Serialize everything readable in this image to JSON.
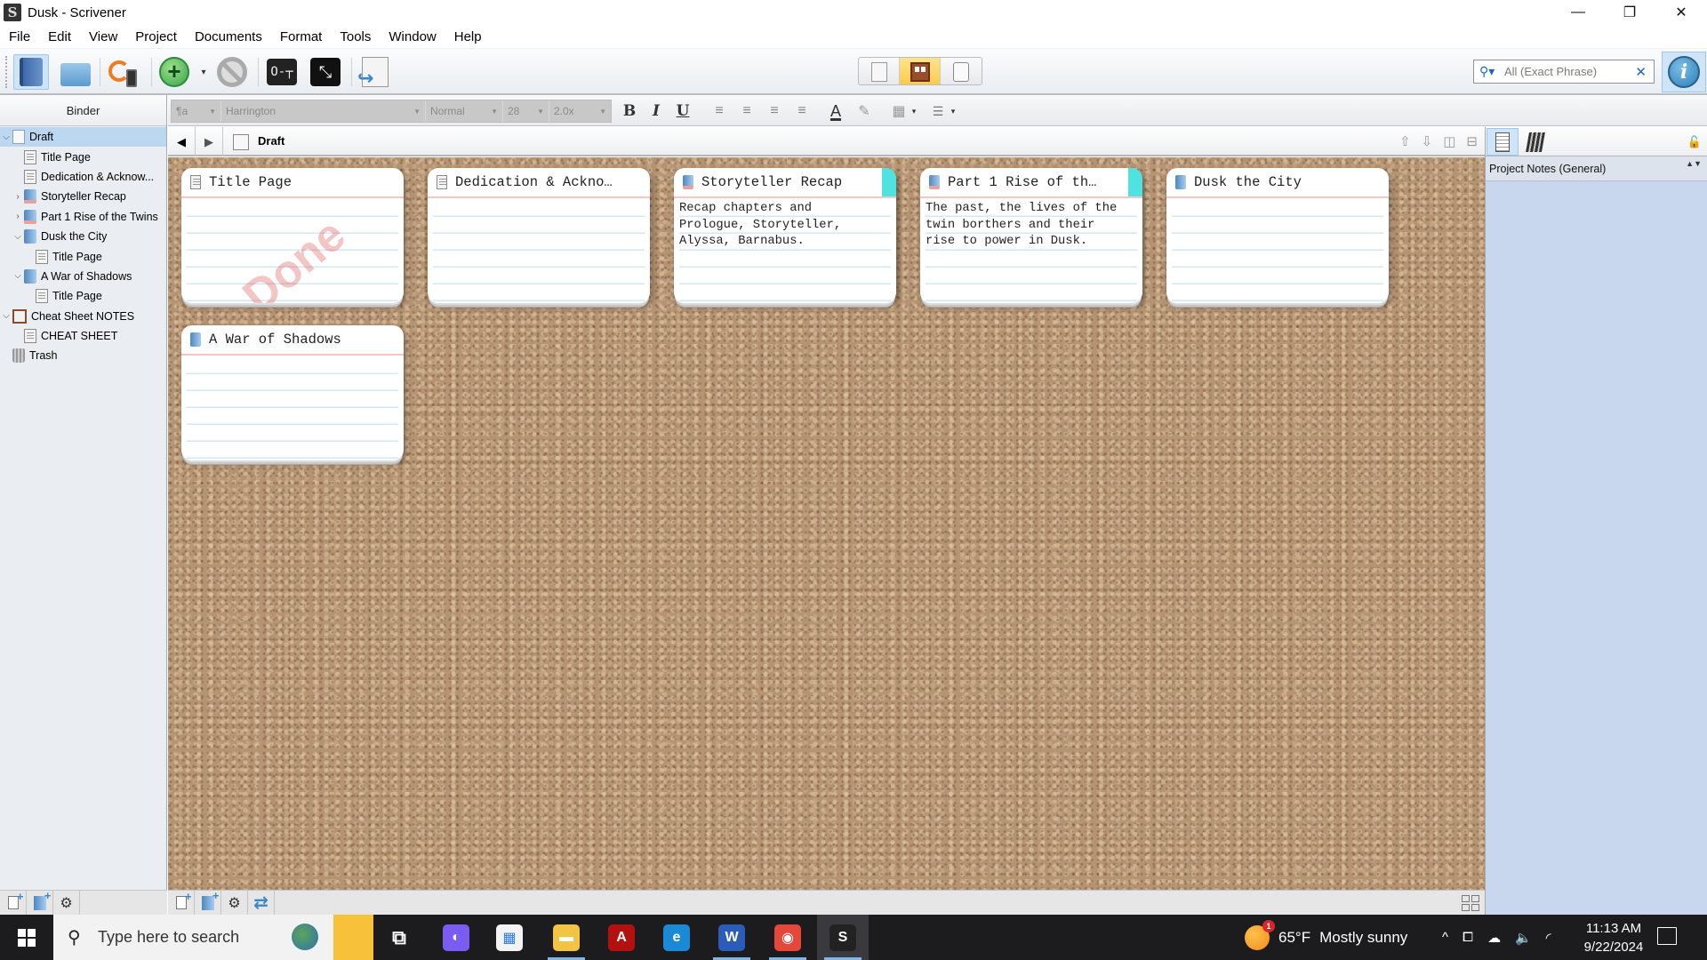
{
  "window": {
    "title": "Dusk - Scrivener",
    "app_icon": "S",
    "controls": {
      "minimize": "—",
      "restore": "❐",
      "close": "✕"
    }
  },
  "menu": [
    "File",
    "Edit",
    "View",
    "Project",
    "Documents",
    "Format",
    "Tools",
    "Window",
    "Help"
  ],
  "toolbar": {
    "buttons": [
      {
        "name": "binder-toggle",
        "icon": "binder-icon",
        "active": true
      },
      {
        "name": "collections",
        "icon": "folder-icon"
      },
      {
        "name": "sync",
        "icon": "sync-icon"
      },
      {
        "name": "add",
        "icon": "add-icon",
        "glyph": "+"
      },
      {
        "name": "delete",
        "icon": "no-icon"
      },
      {
        "name": "keywords",
        "icon": "key-icon",
        "glyph": "O-┬"
      },
      {
        "name": "composition-mode",
        "icon": "fullscreen-icon",
        "glyph": "⤡"
      },
      {
        "name": "compile",
        "icon": "compile-icon"
      }
    ],
    "add_dropdown": "▾",
    "view_modes": [
      {
        "name": "scrivenings",
        "active": false
      },
      {
        "name": "corkboard",
        "active": true
      },
      {
        "name": "outliner",
        "active": false
      }
    ],
    "search": {
      "icon": "⚲▾",
      "placeholder": "All (Exact Phrase)",
      "clear": "✕"
    },
    "inspector_glyph": "i"
  },
  "format_bar": {
    "style_glyph": "¶a",
    "font": "Harrington",
    "typeface": "Normal",
    "size": "28",
    "line_spacing": "2.0x",
    "dropdown_glyph": "▼",
    "bold": "B",
    "italic": "I",
    "underline": "U",
    "align_glyph": "≡",
    "text_color": "A",
    "highlight": "✎",
    "table": "▦",
    "list": "☰",
    "caret": "▾"
  },
  "binder": {
    "header": "Binder",
    "items": [
      {
        "label": "Draft",
        "depth": 0,
        "twisty": "open",
        "icon": "draft",
        "selected": true
      },
      {
        "label": "Title Page",
        "depth": 1,
        "twisty": "none",
        "icon": "doc"
      },
      {
        "label": "Dedication & Acknow...",
        "depth": 1,
        "twisty": "none",
        "icon": "doc"
      },
      {
        "label": "Storyteller Recap",
        "depth": 1,
        "twisty": "closed",
        "icon": "folder-marked"
      },
      {
        "label": "Part 1 Rise of the Twins",
        "depth": 1,
        "twisty": "closed",
        "icon": "folder-marked"
      },
      {
        "label": "Dusk the City",
        "depth": 1,
        "twisty": "open",
        "icon": "folder"
      },
      {
        "label": "Title Page",
        "depth": 2,
        "twisty": "none",
        "icon": "doc"
      },
      {
        "label": "A War of Shadows",
        "depth": 1,
        "twisty": "open",
        "icon": "folder"
      },
      {
        "label": "Title Page",
        "depth": 2,
        "twisty": "none",
        "icon": "doc"
      },
      {
        "label": "Cheat Sheet NOTES",
        "depth": 0,
        "twisty": "open",
        "icon": "cheat"
      },
      {
        "label": "CHEAT SHEET",
        "depth": 1,
        "twisty": "none",
        "icon": "doc"
      },
      {
        "label": "Trash",
        "depth": 0,
        "twisty": "none",
        "icon": "trash"
      }
    ],
    "twisty_open": "⌵",
    "twisty_closed": "›",
    "footer_gear": "⚙"
  },
  "editor": {
    "back": "◀",
    "forward": "▶",
    "title": "Draft",
    "header_icons": [
      "⇧",
      "⇩",
      "◫",
      "⊟"
    ],
    "swap_glyph": "⇄"
  },
  "corkboard": {
    "cards": [
      {
        "title": "Title Page",
        "icon": "doc",
        "synopsis": "",
        "stamp": "Done",
        "label_color": null
      },
      {
        "title": "Dedication & Ackno…",
        "icon": "doc",
        "synopsis": "",
        "stamp": null,
        "label_color": null
      },
      {
        "title": "Storyteller Recap",
        "icon": "folder-marked",
        "synopsis": "Recap chapters and\nPrologue, Storyteller,\nAlyssa, Barnabus.",
        "stamp": null,
        "label_color": "#4ee3e0"
      },
      {
        "title": "Part 1 Rise of th…",
        "icon": "folder-marked",
        "synopsis": "The past, the lives of the\ntwin borthers and their\nrise to power in Dusk.",
        "stamp": null,
        "label_color": "#4ee3e0"
      },
      {
        "title": "Dusk the City",
        "icon": "folder",
        "synopsis": "",
        "stamp": null,
        "label_color": null
      },
      {
        "title": "A War of Shadows",
        "icon": "folder",
        "synopsis": "",
        "stamp": null,
        "label_color": null
      }
    ]
  },
  "inspector": {
    "notes_header": "Project Notes (General)",
    "sort_glyph": "▲▼",
    "lock_glyph": "🔓"
  },
  "taskbar": {
    "search_placeholder": "Type here to search",
    "search_icon": "⚲",
    "apps": [
      {
        "name": "task-view",
        "glyph": "⧉",
        "color": "transparent",
        "running": false
      },
      {
        "name": "copilot",
        "glyph": "◐",
        "color": "#7b5cf0",
        "running": false
      },
      {
        "name": "microsoft-store",
        "glyph": "▦",
        "color": "#f3f3f3",
        "running": false
      },
      {
        "name": "file-explorer",
        "glyph": "▬",
        "color": "#f2c443",
        "running": true
      },
      {
        "name": "acrobat",
        "glyph": "A",
        "color": "#b31010",
        "running": false
      },
      {
        "name": "edge",
        "glyph": "e",
        "color": "#1b8ad6",
        "running": false
      },
      {
        "name": "word",
        "glyph": "W",
        "color": "#2b5cb8",
        "running": true
      },
      {
        "name": "chrome",
        "glyph": "◉",
        "color": "#e5473b",
        "running": true
      },
      {
        "name": "scrivener",
        "glyph": "S",
        "color": "#222",
        "running": true,
        "current": true
      }
    ],
    "weather": {
      "temp": "65°F",
      "condition": "Mostly sunny",
      "badge": "1"
    },
    "tray_glyphs": [
      "^",
      "⧠",
      "☁",
      "🔈",
      "◜"
    ],
    "time": "11:13 AM",
    "date": "9/22/2024"
  }
}
